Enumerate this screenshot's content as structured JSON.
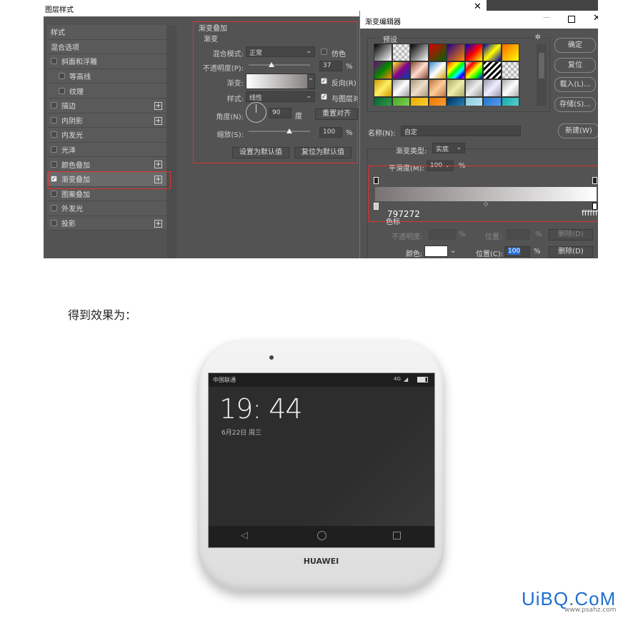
{
  "layer_style": {
    "title": "图层样式",
    "close": "✕",
    "items": [
      {
        "label": "样式",
        "check": null,
        "plus": false
      },
      {
        "label": "混合选项",
        "check": null,
        "plus": false
      },
      {
        "label": "斜面和浮雕",
        "check": false,
        "plus": false
      },
      {
        "label": "等高线",
        "check": false,
        "plus": false,
        "indent": true
      },
      {
        "label": "纹理",
        "check": false,
        "plus": false,
        "indent": true
      },
      {
        "label": "描边",
        "check": false,
        "plus": true
      },
      {
        "label": "内阴影",
        "check": false,
        "plus": true
      },
      {
        "label": "内发光",
        "check": false,
        "plus": false
      },
      {
        "label": "光泽",
        "check": false,
        "plus": false
      },
      {
        "label": "颜色叠加",
        "check": false,
        "plus": true
      },
      {
        "label": "渐变叠加",
        "check": true,
        "plus": true,
        "active": true
      },
      {
        "label": "图案叠加",
        "check": false,
        "plus": false
      },
      {
        "label": "外发光",
        "check": false,
        "plus": false
      },
      {
        "label": "投影",
        "check": false,
        "plus": true
      }
    ],
    "group_title": "渐变叠加",
    "sub_title": "渐变",
    "blend_label": "混合模式:",
    "blend_value": "正常",
    "dither_label": "仿色",
    "opacity_label": "不透明度(P):",
    "opacity_value": "37",
    "pct": "%",
    "opacity": 37,
    "gradient_label": "渐变:",
    "reverse_label": "反向(R)",
    "style_label": "样式:",
    "style_value": "线性",
    "align_label": "与图层对齐",
    "angle_label": "角度(N):",
    "angle_value": "90",
    "angle_unit": "度",
    "reset_align": "重置对齐",
    "scale_label": "缩放(S):",
    "scale_value": "100",
    "scale": 100,
    "set_default": "设置为默认值",
    "reset_default": "复位为默认值"
  },
  "gradient_editor": {
    "title": "渐变编辑器",
    "presets_label": "预设",
    "ok": "确定",
    "reset": "复位",
    "load": "载入(L)...",
    "save": "存储(S)...",
    "name_label": "名称(N):",
    "name_value": "自定",
    "new": "新建(W)",
    "type_label": "渐变类型:",
    "type_value": "实底",
    "smooth_label": "平滑度(M):",
    "smooth_value": "100",
    "pct": "%",
    "left_color": "797272",
    "right_color": "ffffff",
    "stops_label": "色标",
    "stop_opacity_label": "不透明度:",
    "position_label": "位置:",
    "delete": "删除(D)",
    "color_label": "颜色:",
    "position_c_label": "位置(C):",
    "position_value": "100",
    "colors": {
      "start": "#797272",
      "end": "#ffffff"
    }
  },
  "caption": "得到效果为：",
  "phone": {
    "carrier": "中国联通",
    "network": "4G",
    "time": "19: 44",
    "date": "6月22日 周三",
    "brand": "HUAWEI"
  },
  "watermark": {
    "logo": "UiBQ.CoM",
    "url": "www.psahz.com"
  }
}
